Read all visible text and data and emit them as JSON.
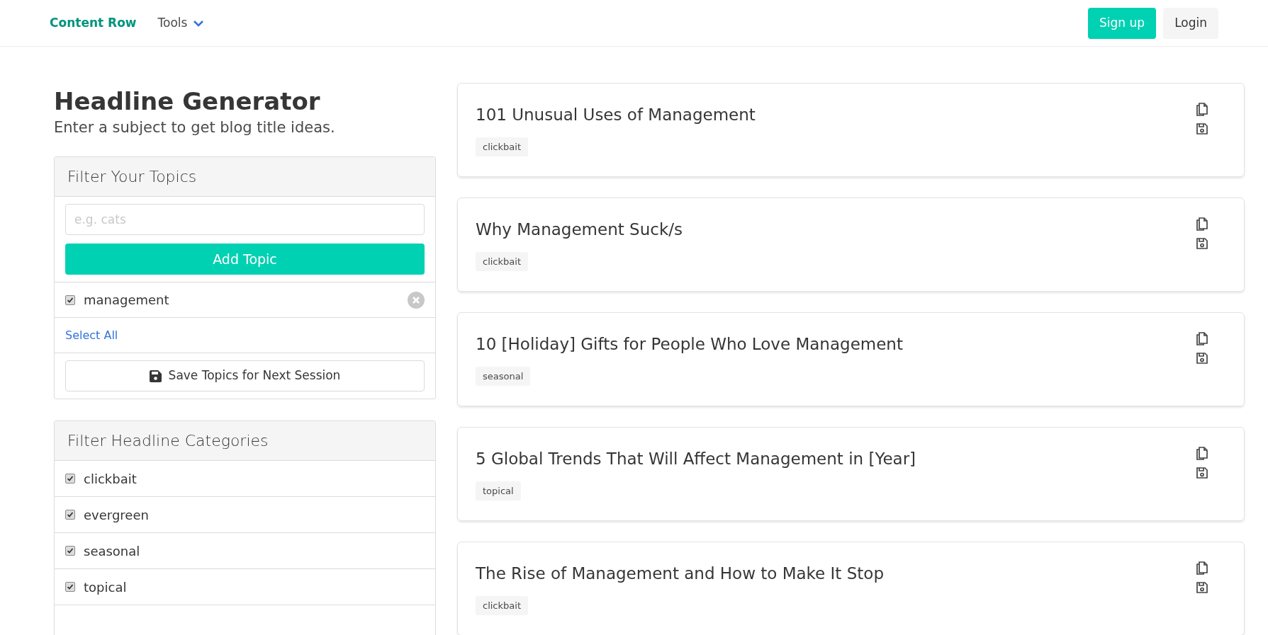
{
  "nav": {
    "brand": "Content Row",
    "menu": "Tools",
    "signup": "Sign up",
    "login": "Login"
  },
  "heading": {
    "title": "Headline Generator",
    "subtitle": "Enter a subject to get blog title ideas."
  },
  "topics_panel": {
    "title": "Filter Your Topics",
    "placeholder": "e.g. cats",
    "add_button": "Add Topic",
    "topics": [
      {
        "label": "management",
        "checked": true
      }
    ],
    "select_all": "Select All",
    "save_button": "Save Topics for Next Session"
  },
  "categories_panel": {
    "title": "Filter Headline Categories",
    "categories": [
      {
        "label": "clickbait",
        "checked": true
      },
      {
        "label": "evergreen",
        "checked": true
      },
      {
        "label": "seasonal",
        "checked": true
      },
      {
        "label": "topical",
        "checked": true
      }
    ]
  },
  "headlines": [
    {
      "title": "101 Unusual Uses of Management",
      "tag": "clickbait"
    },
    {
      "title": "Why Management Suck/s",
      "tag": "clickbait"
    },
    {
      "title": "10 [Holiday] Gifts for People Who Love Management",
      "tag": "seasonal"
    },
    {
      "title": "5 Global Trends That Will Affect Management in [Year]",
      "tag": "topical"
    },
    {
      "title": "The Rise of Management and How to Make It Stop",
      "tag": "clickbait"
    }
  ]
}
